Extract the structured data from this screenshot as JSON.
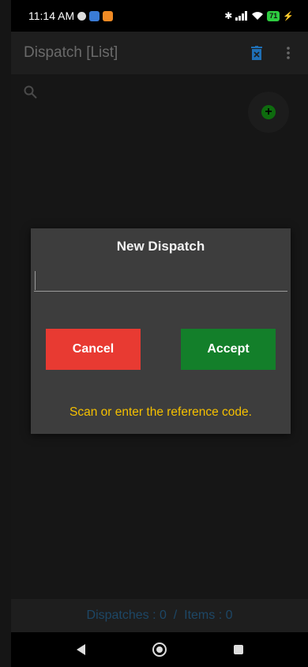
{
  "status_bar": {
    "time": "11:14 AM",
    "battery": "71"
  },
  "app_bar": {
    "title": "Dispatch [List]",
    "delete_icon": "trash-icon",
    "menu_icon": "kebab-menu-icon"
  },
  "content": {
    "search_icon": "search-icon",
    "add_icon": "plus-circle-icon"
  },
  "dialog": {
    "title": "New Dispatch",
    "input_value": "",
    "cancel_label": "Cancel",
    "accept_label": "Accept",
    "hint": "Scan or enter the reference code."
  },
  "footer": {
    "summary": "Dispatches : 0  /  Items : 0"
  },
  "colors": {
    "cancel": "#e83a32",
    "accept": "#137f2a",
    "hint": "#f5c000",
    "accent_blue": "#1f6fb5"
  }
}
